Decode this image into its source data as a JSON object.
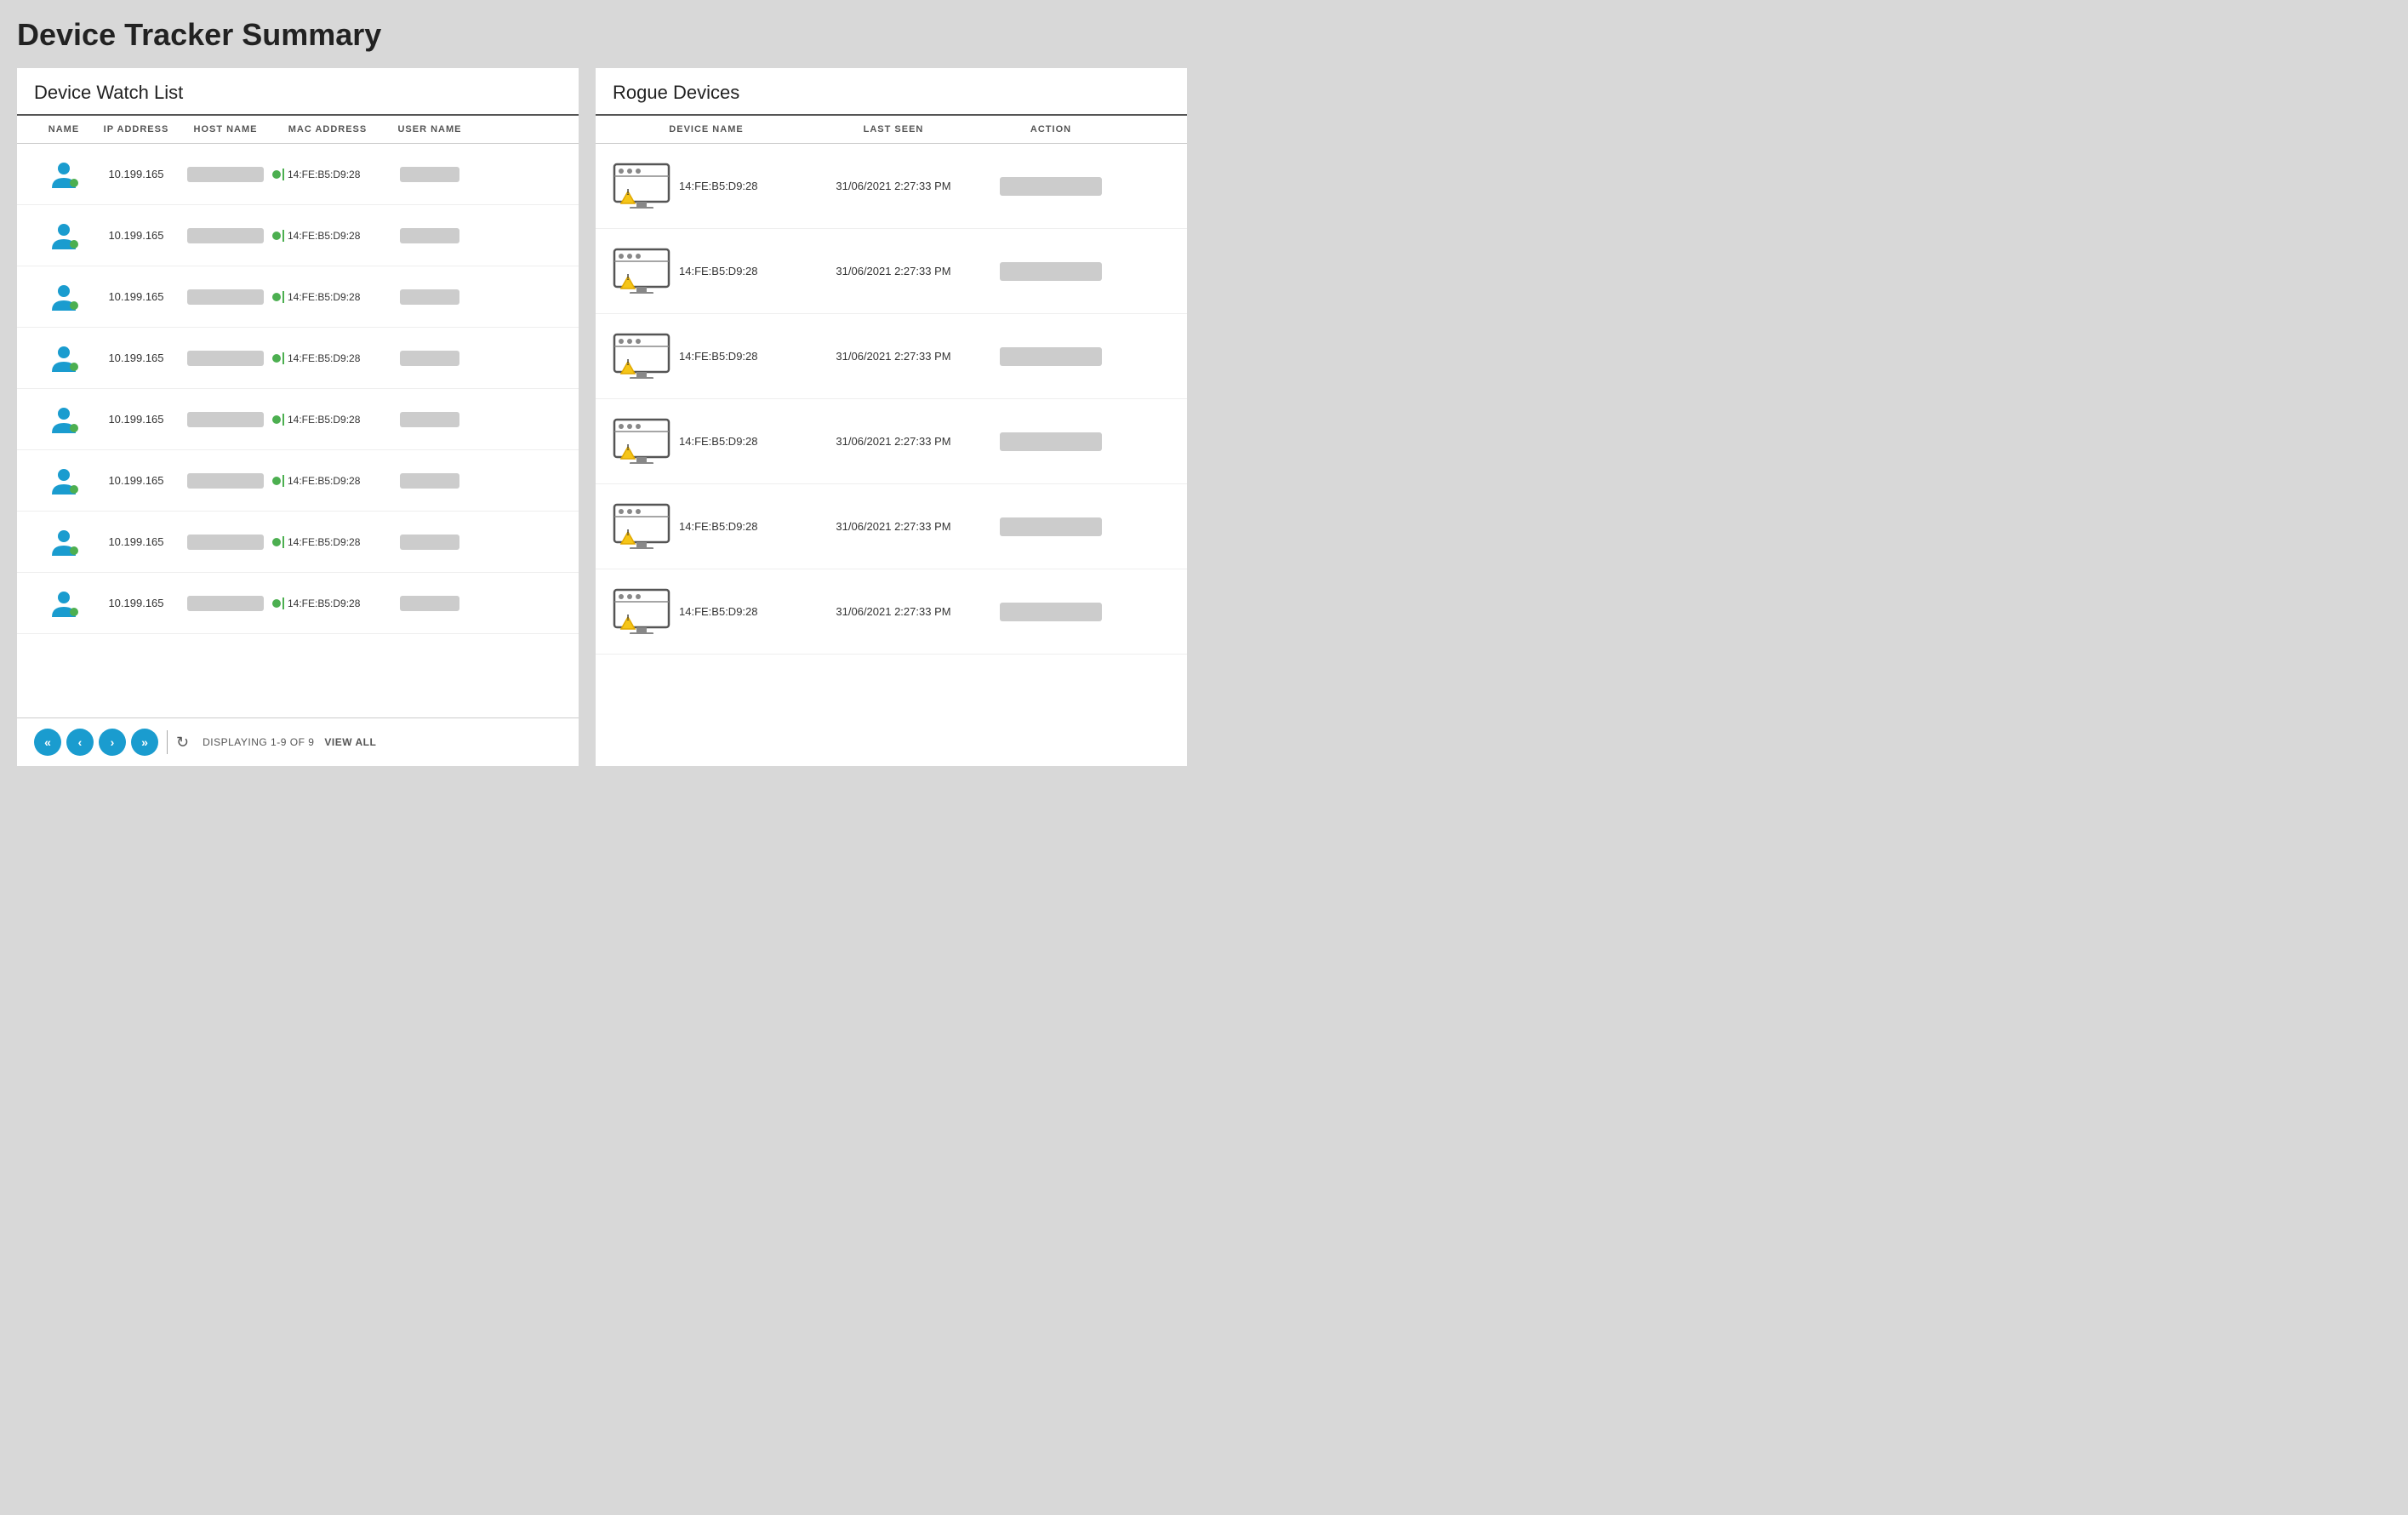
{
  "page": {
    "title": "Device Tracker Summary"
  },
  "watch_list": {
    "panel_title": "Device Watch List",
    "columns": [
      "NAME",
      "IP ADDRESS",
      "HOST NAME",
      "MAC ADDRESS",
      "USER NAME"
    ],
    "rows": [
      {
        "ip": "10.199.165",
        "mac": "14:FE:B5:D9:28"
      },
      {
        "ip": "10.199.165",
        "mac": "14:FE:B5:D9:28"
      },
      {
        "ip": "10.199.165",
        "mac": "14:FE:B5:D9:28"
      },
      {
        "ip": "10.199.165",
        "mac": "14:FE:B5:D9:28"
      },
      {
        "ip": "10.199.165",
        "mac": "14:FE:B5:D9:28"
      },
      {
        "ip": "10.199.165",
        "mac": "14:FE:B5:D9:28"
      },
      {
        "ip": "10.199.165",
        "mac": "14:FE:B5:D9:28"
      },
      {
        "ip": "10.199.165",
        "mac": "14:FE:B5:D9:28"
      }
    ],
    "pagination": {
      "displaying_label": "DISPLAYING 1-9 OF 9",
      "view_all_label": "VIEW ALL"
    }
  },
  "rogue_devices": {
    "panel_title": "Rogue Devices",
    "columns": [
      "DEVICE NAME",
      "LAST SEEN",
      "ACTION"
    ],
    "rows": [
      {
        "mac": "14:FE:B5:D9:28",
        "last_seen": "31/06/2021 2:27:33 PM"
      },
      {
        "mac": "14:FE:B5:D9:28",
        "last_seen": "31/06/2021 2:27:33 PM"
      },
      {
        "mac": "14:FE:B5:D9:28",
        "last_seen": "31/06/2021 2:27:33 PM"
      },
      {
        "mac": "14:FE:B5:D9:28",
        "last_seen": "31/06/2021 2:27:33 PM"
      },
      {
        "mac": "14:FE:B5:D9:28",
        "last_seen": "31/06/2021 2:27:33 PM"
      },
      {
        "mac": "14:FE:B5:D9:28",
        "last_seen": "31/06/2021 2:27:33 PM"
      }
    ]
  },
  "colors": {
    "user_icon": "#1a9ccf",
    "green": "#4caf50",
    "warning": "#f5a623",
    "blue_btn": "#1a9ccf"
  }
}
